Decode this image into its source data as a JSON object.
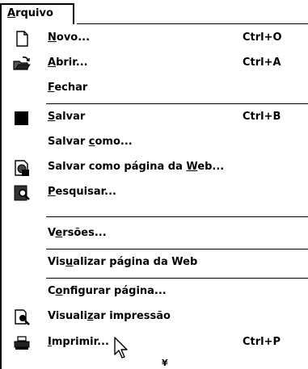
{
  "menu": {
    "title": "Arquivo",
    "title_mnemonic": "A",
    "title_rest": "rquivo",
    "items": [
      {
        "pre": "",
        "mn": "N",
        "post": "ovo...",
        "shortcut": "Ctrl+O",
        "icon": "new-document-icon"
      },
      {
        "pre": "",
        "mn": "A",
        "post": "brir...",
        "shortcut": "Ctrl+A",
        "icon": "open-folder-icon"
      },
      {
        "pre": "",
        "mn": "F",
        "post": "echar",
        "shortcut": "",
        "icon": ""
      },
      {
        "pre": "",
        "mn": "S",
        "post": "alvar",
        "shortcut": "Ctrl+B",
        "icon": "save-icon"
      },
      {
        "pre": "Salvar ",
        "mn": "c",
        "post": "omo...",
        "shortcut": "",
        "icon": ""
      },
      {
        "pre": "Salvar como página da ",
        "mn": "W",
        "post": "eb...",
        "shortcut": "",
        "icon": "save-as-web-icon"
      },
      {
        "pre": "",
        "mn": "P",
        "post": "esquisar...",
        "shortcut": "",
        "icon": "search-file-icon"
      },
      {
        "pre": "V",
        "mn": "e",
        "post": "rsões...",
        "shortcut": "",
        "icon": ""
      },
      {
        "pre": "Vis",
        "mn": "u",
        "post": "alizar página da Web",
        "shortcut": "",
        "icon": ""
      },
      {
        "pre": "C",
        "mn": "o",
        "post": "nfigurar página...",
        "shortcut": "",
        "icon": ""
      },
      {
        "pre": "Visuali",
        "mn": "z",
        "post": "ar impressão",
        "shortcut": "",
        "icon": "print-preview-icon"
      },
      {
        "pre": "",
        "mn": "I",
        "post": "mprimir...",
        "shortcut": "Ctrl+P",
        "icon": "printer-icon"
      }
    ],
    "expand_glyph": "¥"
  }
}
